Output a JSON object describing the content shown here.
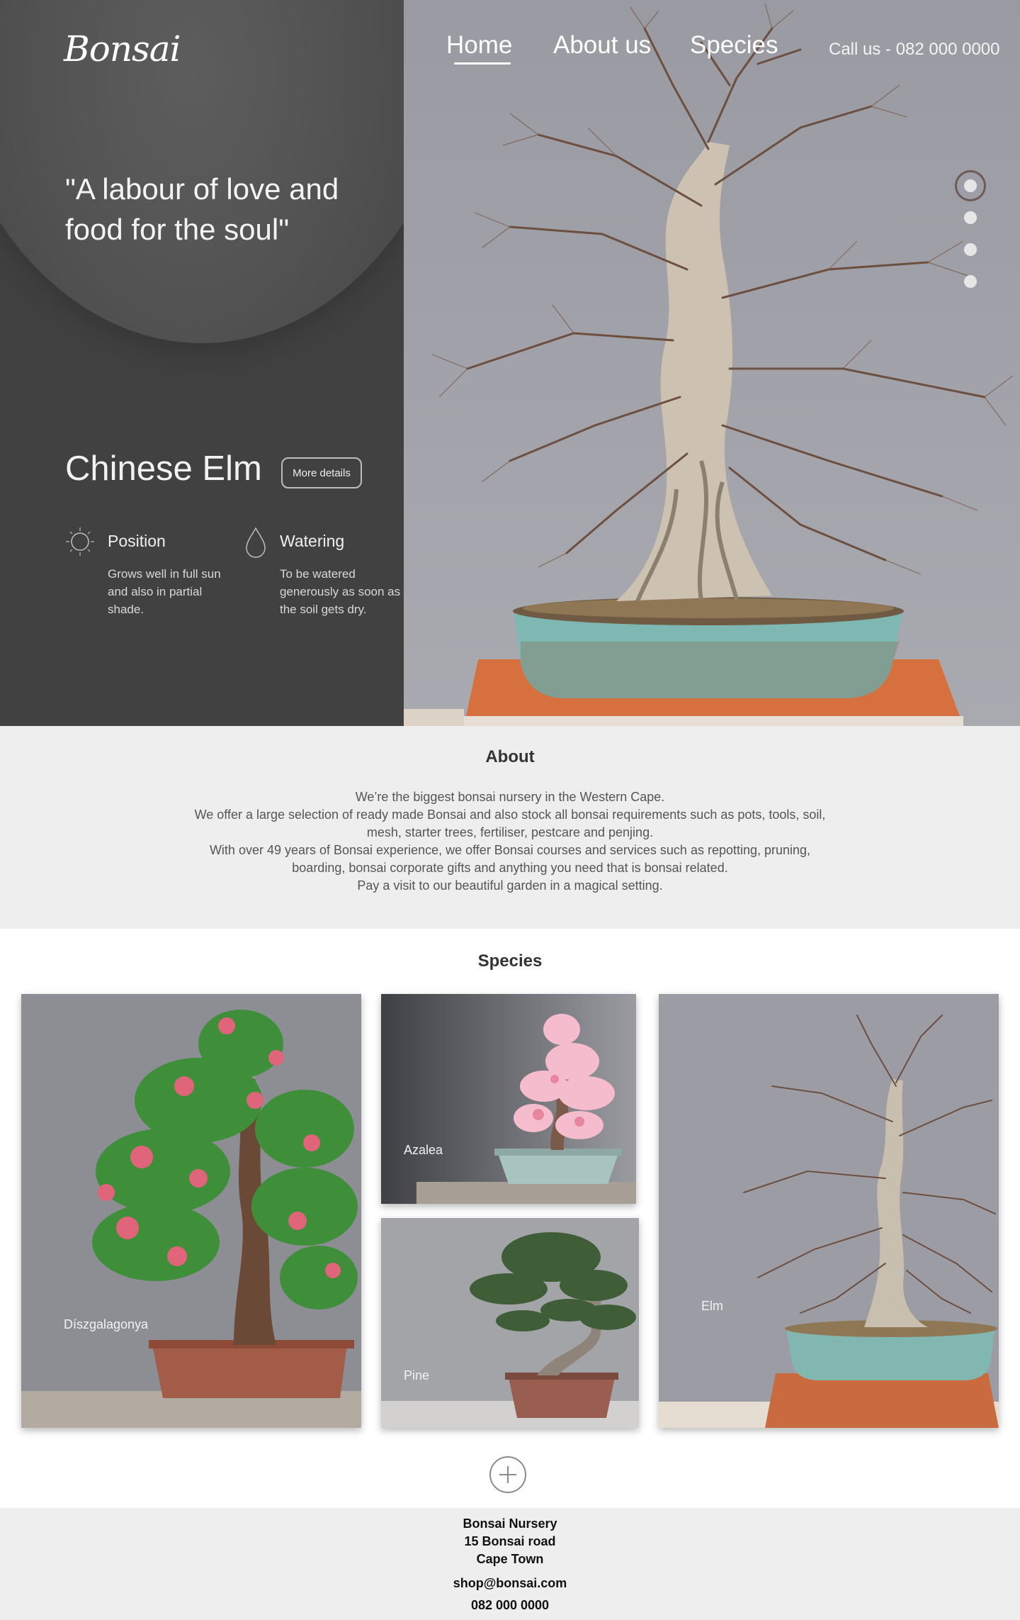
{
  "brand": {
    "logo": "Bonsai"
  },
  "nav": {
    "items": [
      "Home",
      "About us",
      "Species"
    ],
    "active": "Home",
    "call": "Call us - 082 000 0000"
  },
  "hero": {
    "quote": "\"A labour of love and food for the soul\"",
    "species": "Chinese Elm",
    "more_details": "More details",
    "position": {
      "title": "Position",
      "text": "Grows well in full sun and also in partial shade."
    },
    "watering": {
      "title": "Watering",
      "text": "To be watered generously as soon as the soil gets dry."
    },
    "carousel": {
      "slides": 4,
      "active": 1
    }
  },
  "about": {
    "title": "About",
    "lines": [
      "We’re the biggest bonsai nursery in the Western Cape.",
      "We offer a large selection of ready made Bonsai and also stock all bonsai requirements such as pots, tools, soil,",
      "mesh, starter trees, fertiliser, pestcare and penjing.",
      "With over 49 years of Bonsai experience, we offer Bonsai courses and services such as repotting, pruning,",
      "boarding, bonsai corporate gifts and anything you need that is bonsai related.",
      "Pay a visit to our beautiful garden in a magical setting."
    ]
  },
  "species": {
    "title": "Species",
    "cards": [
      {
        "label": "Díszgalagonya"
      },
      {
        "label": "Azalea"
      },
      {
        "label": "Pine"
      },
      {
        "label": "Elm"
      }
    ]
  },
  "footer": {
    "lines": [
      "Bonsai Nursery",
      "15 Bonsai road",
      "Cape Town"
    ],
    "email": "shop@bonsai.com",
    "phone": "082 000 0000"
  },
  "colors": {
    "hero_panel": "#414141",
    "about_bg": "#eeeeee",
    "footer_bg": "#eeeeee",
    "hero_photo_bg": "#a3a4ab"
  },
  "icons": {
    "position": "sun-icon",
    "watering": "water-drop-icon",
    "load_more": "plus-icon"
  }
}
